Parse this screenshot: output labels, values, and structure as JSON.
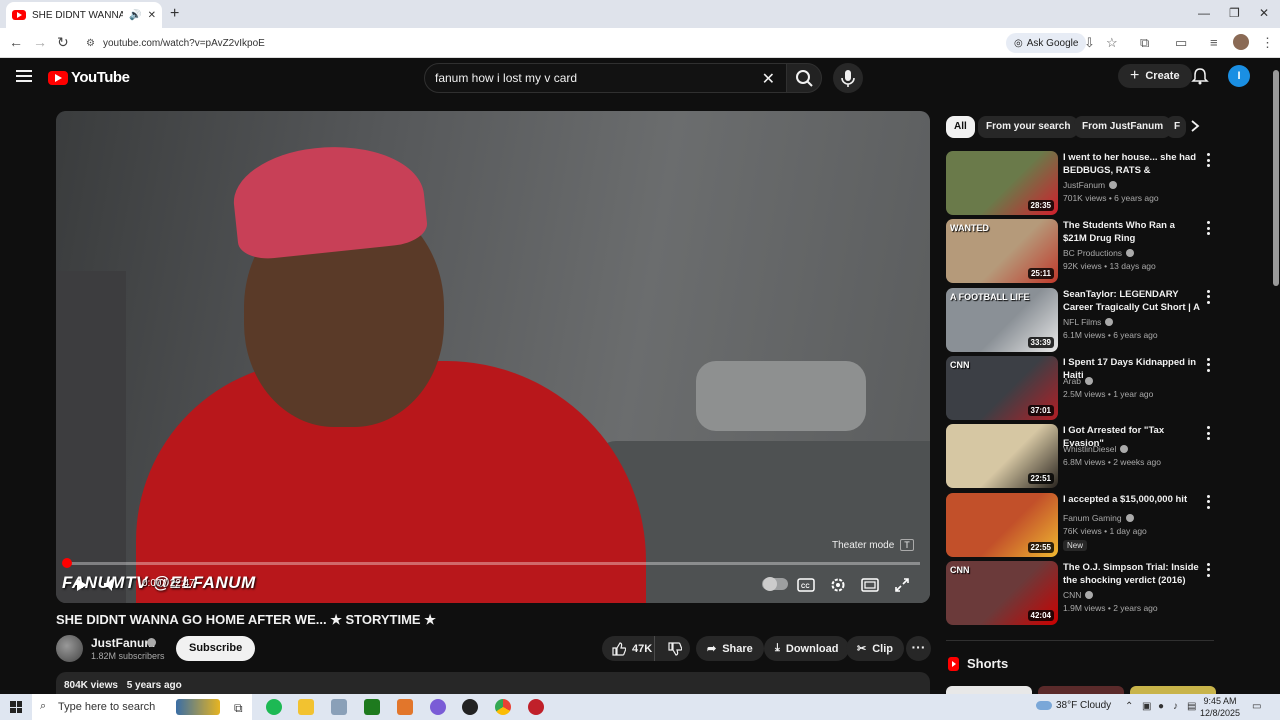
{
  "browser": {
    "tab_title": "SHE DIDNT WANNA GO HOME AFTER WE... ★ STORYTIME ★",
    "tab_title_short": "SHE DIDNT WANNA GO HOM",
    "url": "youtube.com/watch?v=pAvZ2vIkpoE",
    "ask_google": "Ask Google"
  },
  "header": {
    "logo_text": "YouTube",
    "search_value": "fanum how i lost my v card",
    "create_label": "Create",
    "avatar_letter": "I"
  },
  "player": {
    "watermark": "FANUMTV @ELFANUM",
    "time": "0:00 / 22:47",
    "progress_fraction": 0.006,
    "theater_tip": "Theater mode",
    "theater_key": "T"
  },
  "video": {
    "title": "SHE DIDNT WANNA GO HOME AFTER WE... ★ STORYTIME ★",
    "channel": "JustFanum",
    "subscribers": "1.82M subscribers",
    "subscribe_label": "Subscribe",
    "likes": "47K",
    "share_label": "Share",
    "download_label": "Download",
    "clip_label": "Clip",
    "views": "804K views",
    "age": "5 years ago"
  },
  "chips": [
    "All",
    "From your search",
    "From JustFanum",
    "F"
  ],
  "recommendations": [
    {
      "title": "I went to her house... she had BEDBUGS, RATS & ROACHES! ...",
      "channel": "JustFanum",
      "meta": "701K views • 6 years ago",
      "duration": "28:35",
      "thumb_color": "#6a7a4a",
      "accent": "#d21e2c"
    },
    {
      "title": "The Students Who Ran a $21M Drug Ring",
      "channel": "BC Productions",
      "meta": "92K views • 13 days ago",
      "duration": "25:11",
      "thumb_color": "#b59a7a",
      "accent": "#c0392b",
      "thumb_text": "WANTED"
    },
    {
      "title": "SeanTaylor: LEGENDARY Career Tragically Cut Short | A Footba...",
      "channel": "NFL Films",
      "meta": "6.1M views • 6 years ago",
      "duration": "33:39",
      "thumb_color": "#8a9096",
      "accent": "#e8e8e8",
      "thumb_text": "A FOOTBALL LIFE"
    },
    {
      "title": "I Spent 17 Days Kidnapped in Haiti",
      "channel": "Arab",
      "meta": "2.5M views • 1 year ago",
      "duration": "37:01",
      "thumb_color": "#3c3f45",
      "accent": "#b31e25",
      "thumb_text": "CNN"
    },
    {
      "title": "I Got Arrested for \"Tax Evasion\"",
      "channel": "WhistlinDiesel",
      "meta": "6.8M views • 2 weeks ago",
      "duration": "22:51",
      "thumb_color": "#d6c7a3",
      "accent": "#2a2520"
    },
    {
      "title": "I accepted a $15,000,000 hit",
      "channel": "Fanum Gaming",
      "meta": "76K views • 1 day ago",
      "duration": "22:55",
      "thumb_color": "#c2502a",
      "accent": "#f0b830",
      "badge": "New"
    },
    {
      "title": "The O.J. Simpson Trial: Inside the shocking verdict (2016)",
      "channel": "CNN",
      "meta": "1.9M views • 2 years ago",
      "duration": "42:04",
      "thumb_color": "#6b3a3a",
      "accent": "#cc0000",
      "thumb_text": "CNN"
    }
  ],
  "shorts_label": "Shorts",
  "taskbar": {
    "search_placeholder": "Type here to search",
    "weather": "38°F  Cloudy",
    "time": "9:45 AM",
    "date": "12/8/2025"
  }
}
